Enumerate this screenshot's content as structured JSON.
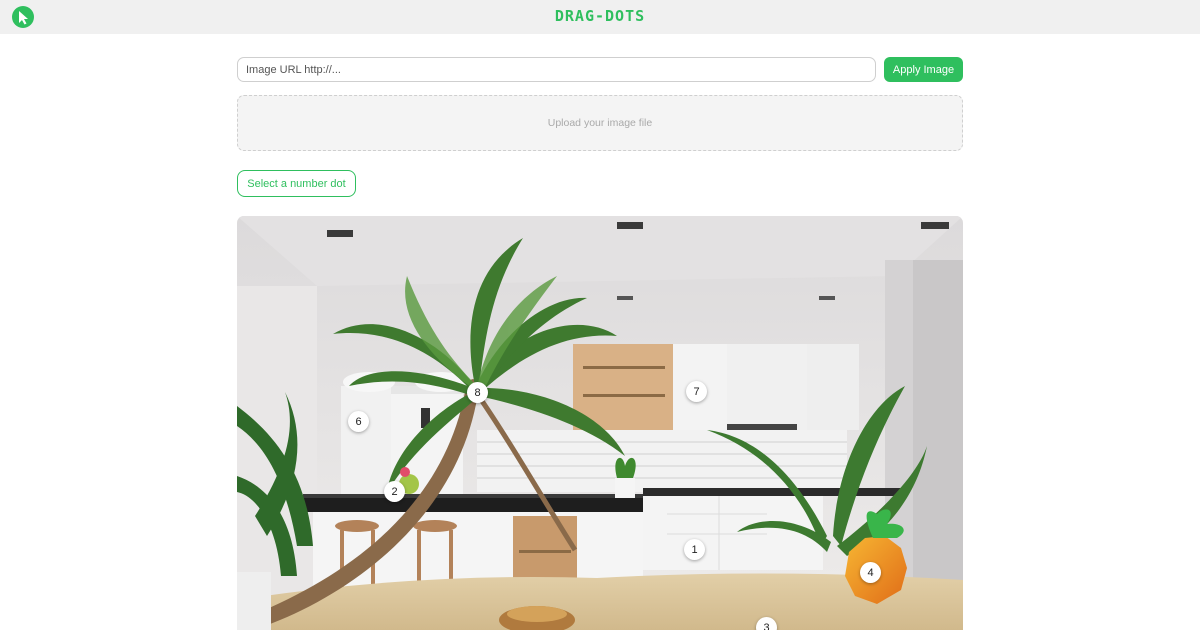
{
  "header": {
    "brand": "DRAG-DOTS",
    "logo_icon": "drag-dots-logo-icon"
  },
  "url_input": {
    "placeholder": "Image URL http://...",
    "value": ""
  },
  "apply_button": {
    "label": "Apply Image"
  },
  "upload": {
    "label": "Upload your image file"
  },
  "select_button": {
    "label": "Select a number dot"
  },
  "dots": [
    {
      "number": "1"
    },
    {
      "number": "2"
    },
    {
      "number": "3"
    },
    {
      "number": "4"
    },
    {
      "number": "6"
    },
    {
      "number": "7"
    },
    {
      "number": "8"
    }
  ],
  "colors": {
    "accent": "#2fbf5e",
    "topbar": "#f0f0f0"
  }
}
